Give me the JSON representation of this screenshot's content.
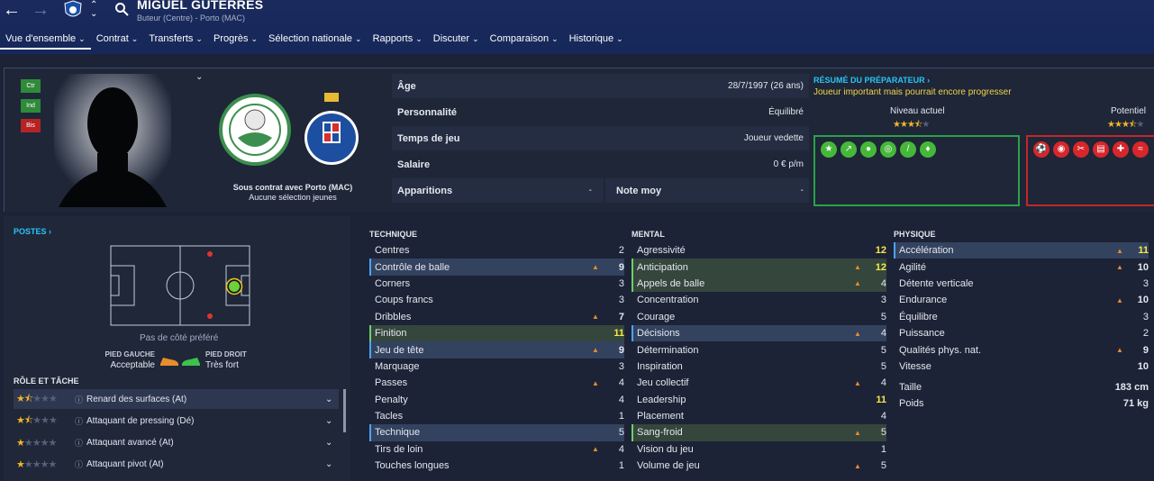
{
  "header": {
    "player_name": "MIGUEL GUTERRES",
    "subtitle": "Buteur (Centre) - Porto (MAC)"
  },
  "menu": [
    {
      "label": "Vue d'ensemble"
    },
    {
      "label": "Contrat"
    },
    {
      "label": "Transferts"
    },
    {
      "label": "Progrès"
    },
    {
      "label": "Sélection nationale"
    },
    {
      "label": "Rapports"
    },
    {
      "label": "Discuter"
    },
    {
      "label": "Comparaison"
    },
    {
      "label": "Historique"
    }
  ],
  "badges": [
    {
      "label": "Ctr",
      "color": "#2f8a3a"
    },
    {
      "label": "Ind",
      "color": "#2f8a3a"
    },
    {
      "label": "Bis",
      "color": "#b52323"
    }
  ],
  "contract": {
    "line1": "Sous contrat avec Porto (MAC)",
    "line2": "Aucune sélection jeunes"
  },
  "info": {
    "age_label": "Âge",
    "age_value": "28/7/1997 (26 ans)",
    "personality_label": "Personnalité",
    "personality_value": "Équilibré",
    "playtime_label": "Temps de jeu",
    "playtime_value": "Joueur vedette",
    "salary_label": "Salaire",
    "salary_value": "0 € p/m",
    "apps_label": "Apparitions",
    "apps_value": "-",
    "rating_label": "Note moy",
    "rating_value": "-"
  },
  "coach": {
    "title": "RÉSUMÉ DU PRÉPARATEUR ›",
    "summary": "Joueur important mais pourrait encore progresser",
    "current_label": "Niveau actuel",
    "current_stars": 3.5,
    "potential_label": "Potentiel",
    "potential_stars": 3.5
  },
  "positions": {
    "title": "POSTES ›",
    "preferred_side": "Pas de côté préféré",
    "left_foot_label": "PIED GAUCHE",
    "left_foot_value": "Acceptable",
    "right_foot_label": "PIED DROIT",
    "right_foot_value": "Très fort"
  },
  "roles": {
    "title": "RÔLE ET TÂCHE",
    "items": [
      {
        "name": "Renard des surfaces (At)",
        "stars": 1.5,
        "chevron": "⌄"
      },
      {
        "name": "Attaquant de pressing (Dé)",
        "stars": 1.5,
        "chevron": "⌄"
      },
      {
        "name": "Attaquant avancé (At)",
        "stars": 1,
        "chevron": "⌄"
      },
      {
        "name": "Attaquant pivot (At)",
        "stars": 1,
        "chevron": "⌄"
      }
    ]
  },
  "technique": {
    "title": "TECHNIQUE",
    "attrs": [
      {
        "name": "Centres",
        "value": "2",
        "trend": false,
        "hl": ""
      },
      {
        "name": "Contrôle de balle",
        "value": "9",
        "trend": true,
        "hl": "blue"
      },
      {
        "name": "Corners",
        "value": "3",
        "trend": false,
        "hl": ""
      },
      {
        "name": "Coups francs",
        "value": "3",
        "trend": false,
        "hl": ""
      },
      {
        "name": "Dribbles",
        "value": "7",
        "trend": true,
        "hl": ""
      },
      {
        "name": "Finition",
        "value": "11",
        "trend": false,
        "hl": "green"
      },
      {
        "name": "Jeu de tête",
        "value": "9",
        "trend": true,
        "hl": "blue"
      },
      {
        "name": "Marquage",
        "value": "3",
        "trend": false,
        "hl": ""
      },
      {
        "name": "Passes",
        "value": "4",
        "trend": true,
        "hl": ""
      },
      {
        "name": "Penalty",
        "value": "4",
        "trend": false,
        "hl": ""
      },
      {
        "name": "Tacles",
        "value": "1",
        "trend": false,
        "hl": ""
      },
      {
        "name": "Technique",
        "value": "5",
        "trend": false,
        "hl": "blue"
      },
      {
        "name": "Tirs de loin",
        "value": "4",
        "trend": true,
        "hl": ""
      },
      {
        "name": "Touches longues",
        "value": "1",
        "trend": false,
        "hl": ""
      }
    ]
  },
  "mental": {
    "title": "MENTAL",
    "attrs": [
      {
        "name": "Agressivité",
        "value": "12",
        "trend": false,
        "hl": ""
      },
      {
        "name": "Anticipation",
        "value": "12",
        "trend": true,
        "hl": "green"
      },
      {
        "name": "Appels de balle",
        "value": "4",
        "trend": true,
        "hl": "green"
      },
      {
        "name": "Concentration",
        "value": "3",
        "trend": false,
        "hl": ""
      },
      {
        "name": "Courage",
        "value": "5",
        "trend": false,
        "hl": ""
      },
      {
        "name": "Décisions",
        "value": "4",
        "trend": true,
        "hl": "blue"
      },
      {
        "name": "Détermination",
        "value": "5",
        "trend": false,
        "hl": ""
      },
      {
        "name": "Inspiration",
        "value": "5",
        "trend": false,
        "hl": ""
      },
      {
        "name": "Jeu collectif",
        "value": "4",
        "trend": true,
        "hl": ""
      },
      {
        "name": "Leadership",
        "value": "11",
        "trend": false,
        "hl": ""
      },
      {
        "name": "Placement",
        "value": "4",
        "trend": false,
        "hl": ""
      },
      {
        "name": "Sang-froid",
        "value": "5",
        "trend": true,
        "hl": "green"
      },
      {
        "name": "Vision du jeu",
        "value": "1",
        "trend": false,
        "hl": ""
      },
      {
        "name": "Volume de jeu",
        "value": "5",
        "trend": true,
        "hl": ""
      }
    ]
  },
  "physique": {
    "title": "PHYSIQUE",
    "attrs": [
      {
        "name": "Accélération",
        "value": "11",
        "trend": true,
        "hl": "blue"
      },
      {
        "name": "Agilité",
        "value": "10",
        "trend": true,
        "hl": ""
      },
      {
        "name": "Détente verticale",
        "value": "3",
        "trend": false,
        "hl": ""
      },
      {
        "name": "Endurance",
        "value": "10",
        "trend": true,
        "hl": ""
      },
      {
        "name": "Équilibre",
        "value": "3",
        "trend": false,
        "hl": ""
      },
      {
        "name": "Puissance",
        "value": "2",
        "trend": false,
        "hl": ""
      },
      {
        "name": "Qualités phys. nat.",
        "value": "9",
        "trend": true,
        "hl": ""
      },
      {
        "name": "Vitesse",
        "value": "10",
        "trend": false,
        "hl": ""
      }
    ],
    "height_label": "Taille",
    "height_value": "183 cm",
    "weight_label": "Poids",
    "weight_value": "71 kg"
  },
  "trend_icon": "arrow-up-icon",
  "colors": {
    "accent": "#29c5f6",
    "highlight_value": "#f5e84a",
    "strength": "#2aa24a",
    "weakness": "#c4262a"
  }
}
